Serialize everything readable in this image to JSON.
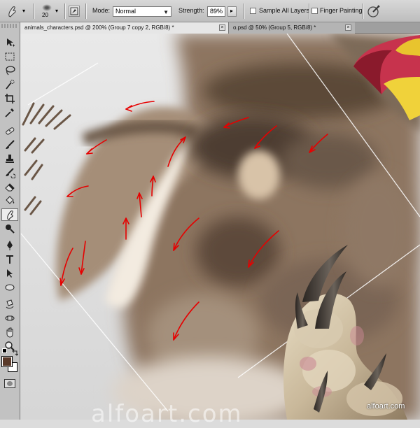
{
  "options_bar": {
    "brush_size": "20",
    "mode_label": "Mode:",
    "mode_value": "Normal",
    "strength_label": "Strength:",
    "strength_value": "89%",
    "sample_all_layers_label": "Sample All Layers",
    "sample_all_layers_checked": false,
    "finger_painting_label": "Finger Painting",
    "finger_painting_checked": false
  },
  "tabs": [
    {
      "label": "animals_characters.psd @ 200% (Group 7 copy 2, RGB/8) *",
      "close": "×",
      "active": true
    },
    {
      "label": "o.psd @ 50% (Group 5, RGB/8) *",
      "close": "×",
      "active": false
    }
  ],
  "tools": [
    "move-icon",
    "marquee-icon",
    "lasso-icon",
    "quick-select-icon",
    "crop-icon",
    "eyedropper-icon",
    "healing-icon",
    "brush-icon",
    "stamp-icon",
    "history-brush-icon",
    "eraser-icon",
    "bucket-icon",
    "smudge-icon",
    "dodge-icon",
    "pen-icon",
    "type-icon",
    "path-select-icon",
    "shape-icon",
    "3d-rotate-icon",
    "3d-orbit-icon",
    "hand-icon",
    "zoom-icon"
  ],
  "active_tool": "smudge-icon",
  "colors": {
    "foreground": "#5a3a2a",
    "background": "#ffffff",
    "arrows": "#e60000"
  },
  "watermark": "alfoart.com",
  "site_label": "alfoart.com"
}
